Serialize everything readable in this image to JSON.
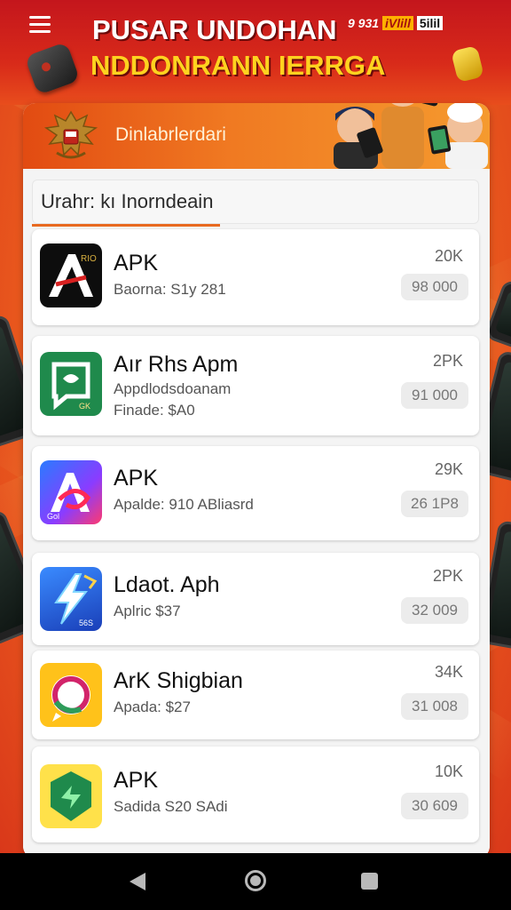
{
  "banner": {
    "title_line1": "PUSAR UNDOHAN",
    "title_line2": "NDDONRANN IERRGA",
    "status_a": "9 931",
    "status_b": "iVlill",
    "status_c": "5ilil"
  },
  "card": {
    "header_label": "Dinlabrlerdari",
    "search_text": "Urahr: kı Inorndeain"
  },
  "apps": [
    {
      "name": "APK",
      "sub": "Baorna: S1y 281",
      "sub2": "",
      "count": "20K",
      "price": "98 000"
    },
    {
      "name": "Aır Rhs Apm",
      "sub": "Appdlodsdoanam",
      "sub2": "Finade: $A0",
      "count": "2PK",
      "price": "91 000"
    },
    {
      "name": "APK",
      "sub": "Apalde: 910 ABliasrd",
      "sub2": "",
      "count": "29K",
      "price": "26 1P8"
    },
    {
      "name": "Ldaot. Aph",
      "sub": "Aplric  $37",
      "sub2": "",
      "count": "2PK",
      "price": "32 009"
    },
    {
      "name": "ArK Shigbian",
      "sub": "Apada: $27",
      "sub2": "",
      "count": "34K",
      "price": "31 008"
    },
    {
      "name": "APK",
      "sub": "Sadida  S20 SAdi",
      "sub2": "",
      "count": "10K",
      "price": "30 609"
    }
  ],
  "icons": {
    "menu": "menu-icon",
    "emblem": "garuda-emblem-icon",
    "back": "back-icon",
    "home": "home-icon",
    "recent": "recent-apps-icon"
  },
  "colors": {
    "banner_red": "#c4161c",
    "banner_yellow": "#ffd21f",
    "header_orange": "#f07a22",
    "accent_underline": "#e86a20"
  }
}
